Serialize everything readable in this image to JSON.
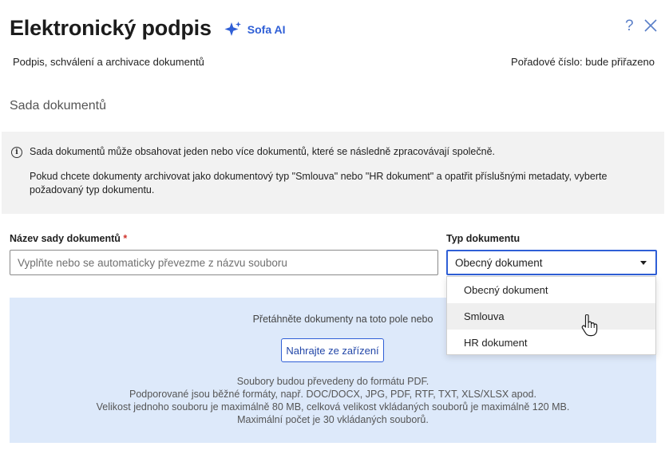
{
  "header": {
    "title": "Elektronický podpis",
    "ai_label": "Sofa AI",
    "help_glyph": "?"
  },
  "subtitle": "Podpis, schválení a archivace dokumentů",
  "order_number": "Pořadové číslo: bude přiřazeno",
  "section_title": "Sada dokumentů",
  "info": {
    "icon_glyph": "i",
    "line1": "Sada dokumentů může obsahovat jeden nebo více dokumentů, které se následně zpracovávají společně.",
    "line2": "Pokud chcete dokumenty archivovat jako dokumentový typ \"Smlouva\" nebo \"HR dokument\" a opatřit příslušnými metadaty, vyberte požadovaný typ dokumentu."
  },
  "form": {
    "name_label": "Název sady dokumentů",
    "required_mark": "*",
    "name_value": "",
    "name_placeholder": "Vyplňte nebo se automaticky převezme z názvu souboru",
    "type_label": "Typ dokumentu",
    "type_selected": "Obecný dokument",
    "type_options": [
      "Obecný dokument",
      "Smlouva",
      "HR dokument"
    ],
    "hovered_option": "Smlouva"
  },
  "dropzone": {
    "lead": "Přetáhněte dokumenty na toto pole nebo",
    "button_label": "Nahrajte ze zařízení",
    "note1": "Soubory budou převedeny do formátu PDF.",
    "note2": "Podporované jsou běžné formáty, např. DOC/DOCX, JPG, PDF, RTF, TXT, XLS/XLSX apod.",
    "note3": "Velikost jednoho souboru je maximálně 80 MB, celková velikost vkládaných souborů je maximálně 120 MB.",
    "note4": "Maximální počet je 30 vkládaných souborů."
  },
  "colors": {
    "accent": "#2f5fd6",
    "info_bg": "#f2f2f2",
    "dropzone_bg": "#dde9fa",
    "required": "#d0342c"
  },
  "icons": {
    "ai": "sparkle-icon",
    "help": "help-icon",
    "close": "close-icon",
    "info": "info-icon",
    "caret": "caret-down-icon",
    "cursor": "hand-pointer-icon"
  }
}
